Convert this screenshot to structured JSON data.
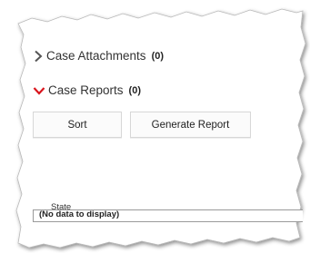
{
  "attachments_section": {
    "title": "Case Attachments",
    "count": "(0)",
    "icon": "chevron-right-icon",
    "expanded": false
  },
  "reports_section": {
    "title": "Case Reports",
    "count": "(0)",
    "icon": "chevron-down-icon",
    "expanded": true,
    "chevron_color": "#d9141c"
  },
  "toolbar": {
    "sort_label": "Sort",
    "generate_label": "Generate Report"
  },
  "grid": {
    "columns": [
      "State"
    ],
    "empty_message": "(No data to display)"
  }
}
